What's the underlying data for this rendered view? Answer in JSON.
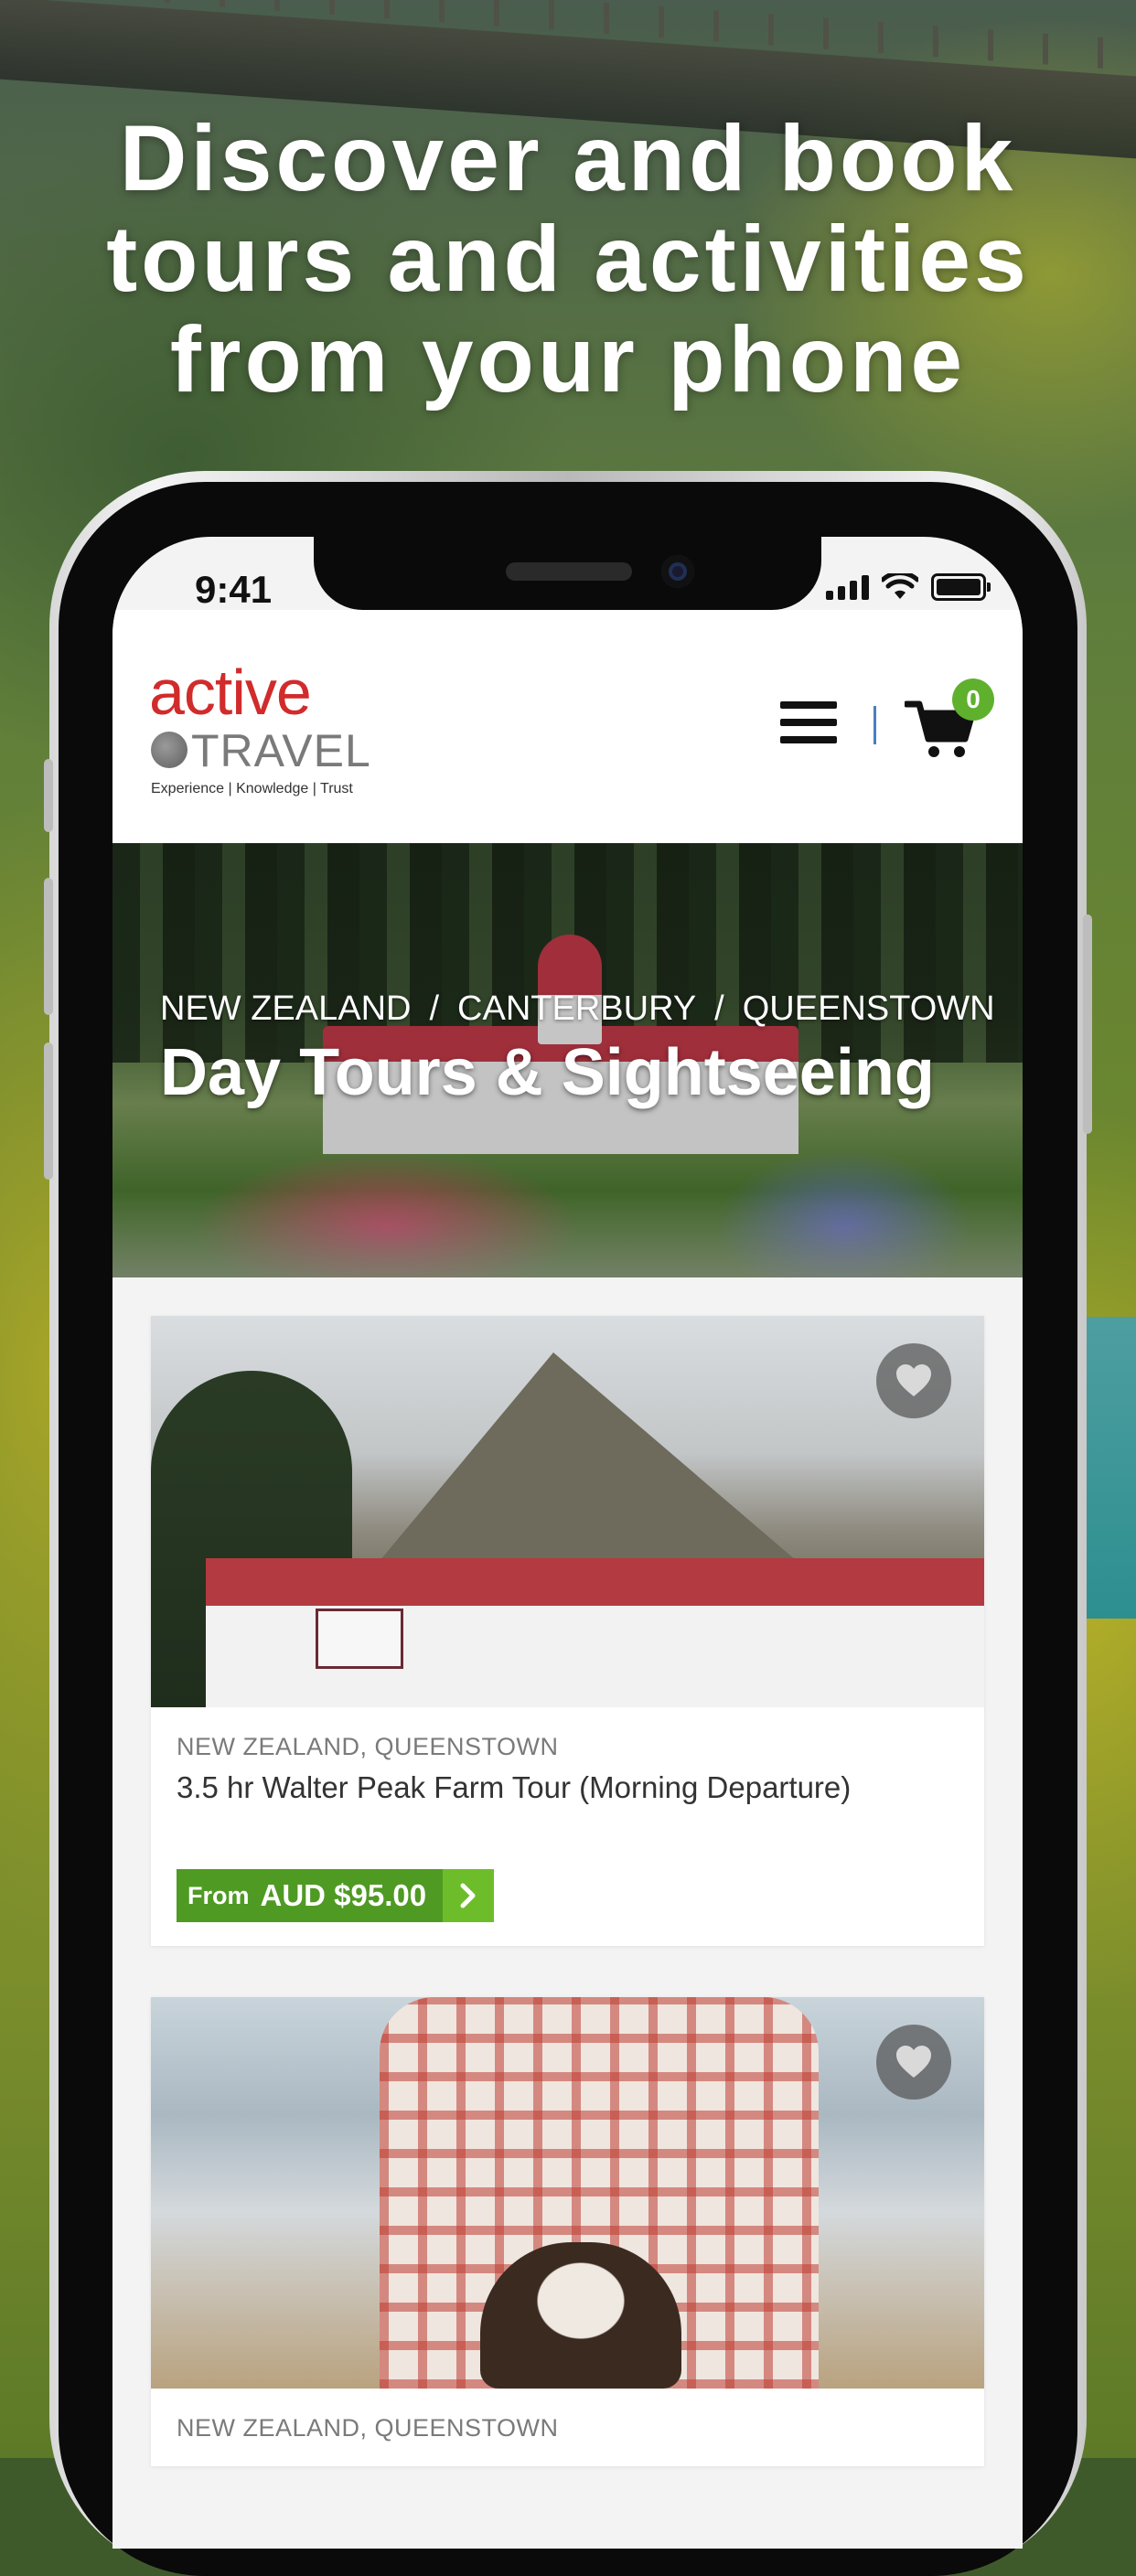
{
  "promo": {
    "headline": [
      "Discover and book",
      "tours and activities",
      "from your phone"
    ]
  },
  "status_bar": {
    "time": "9:41"
  },
  "header": {
    "logo_primary": "active",
    "logo_secondary": "TRAVEL",
    "logo_tagline": "Experience | Knowledge | Trust",
    "cart_count": "0"
  },
  "hero": {
    "breadcrumb": [
      "NEW ZEALAND",
      "CANTERBURY",
      "QUEENSTOWN"
    ],
    "separator": "/",
    "title": "Day Tours & Sightseeing"
  },
  "listings": [
    {
      "location": "NEW ZEALAND, QUEENSTOWN",
      "title": "3.5 hr Walter Peak Farm Tour (Morning Departure)",
      "price_prefix": "From",
      "price": "AUD $95.00"
    },
    {
      "location": "NEW ZEALAND, QUEENSTOWN"
    }
  ],
  "colors": {
    "brand_red": "#d12b2b",
    "accent_green": "#4f9a23",
    "badge_green": "#5fb12d"
  }
}
